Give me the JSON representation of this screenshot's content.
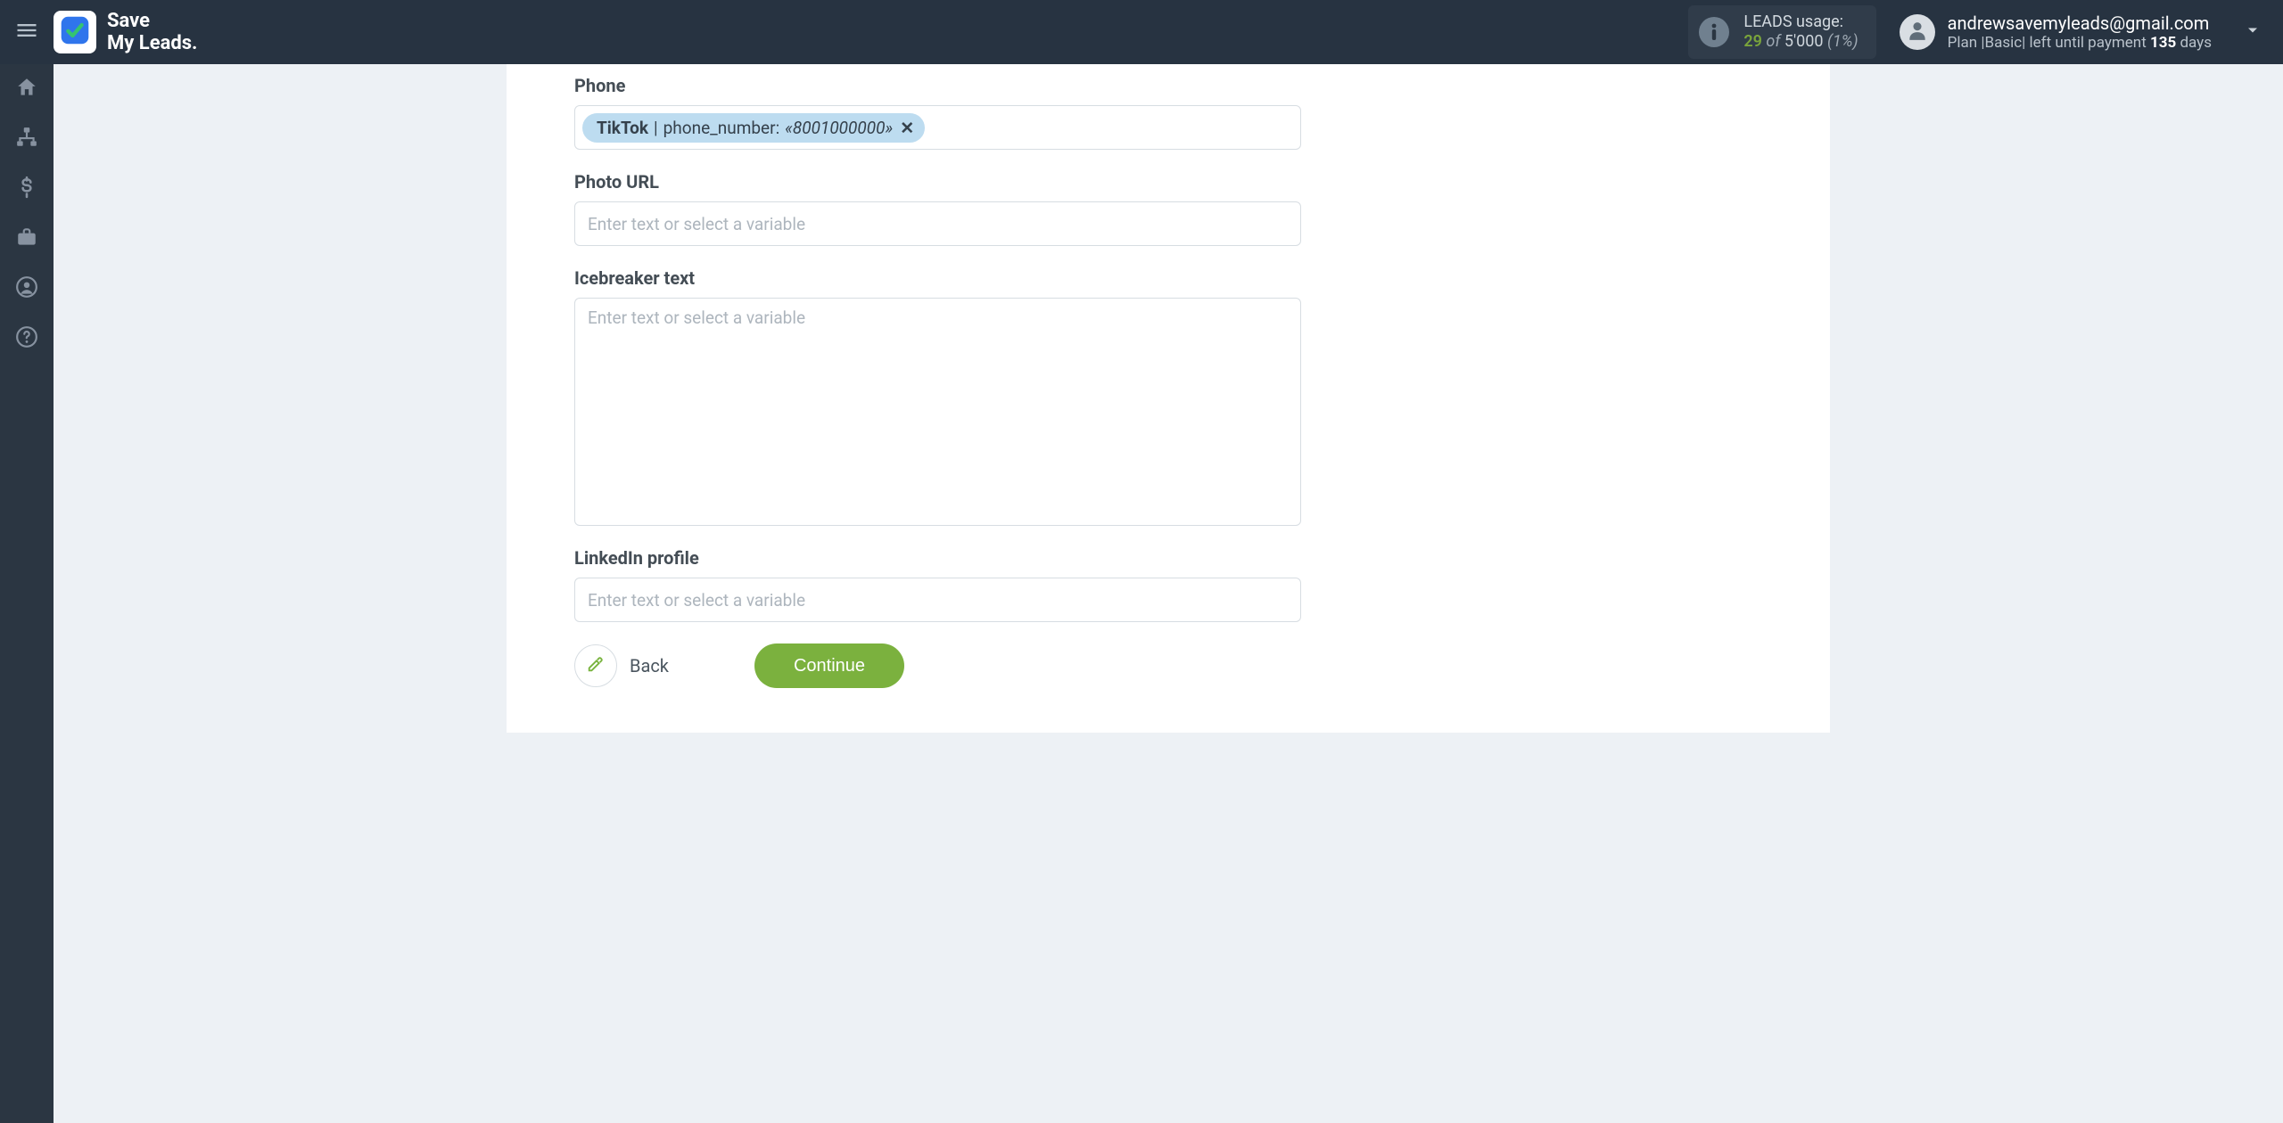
{
  "brand": {
    "line1": "Save",
    "line2": "My Leads."
  },
  "usage": {
    "title": "LEADS usage:",
    "used": "29",
    "of_word": "of",
    "total": "5'000",
    "percent": "(1%)"
  },
  "account": {
    "email": "andrewsavemyleads@gmail.com",
    "plan_prefix": "Plan |",
    "plan_name": "Basic",
    "plan_sep": "|",
    "left_text": "left until payment",
    "days_number": "135",
    "days_word": "days"
  },
  "sidebar": {
    "items": [
      {
        "name": "home"
      },
      {
        "name": "integrations"
      },
      {
        "name": "billing"
      },
      {
        "name": "briefcase"
      },
      {
        "name": "account"
      },
      {
        "name": "help"
      }
    ]
  },
  "form": {
    "phone": {
      "label": "Phone",
      "tag_source": "TikTok",
      "tag_field": "phone_number",
      "tag_value": "«8001000000»"
    },
    "photo_url": {
      "label": "Photo URL"
    },
    "icebreaker": {
      "label": "Icebreaker text"
    },
    "linkedin": {
      "label": "LinkedIn profile"
    },
    "placeholder": "Enter text or select a variable"
  },
  "actions": {
    "back": "Back",
    "continue": "Continue"
  }
}
